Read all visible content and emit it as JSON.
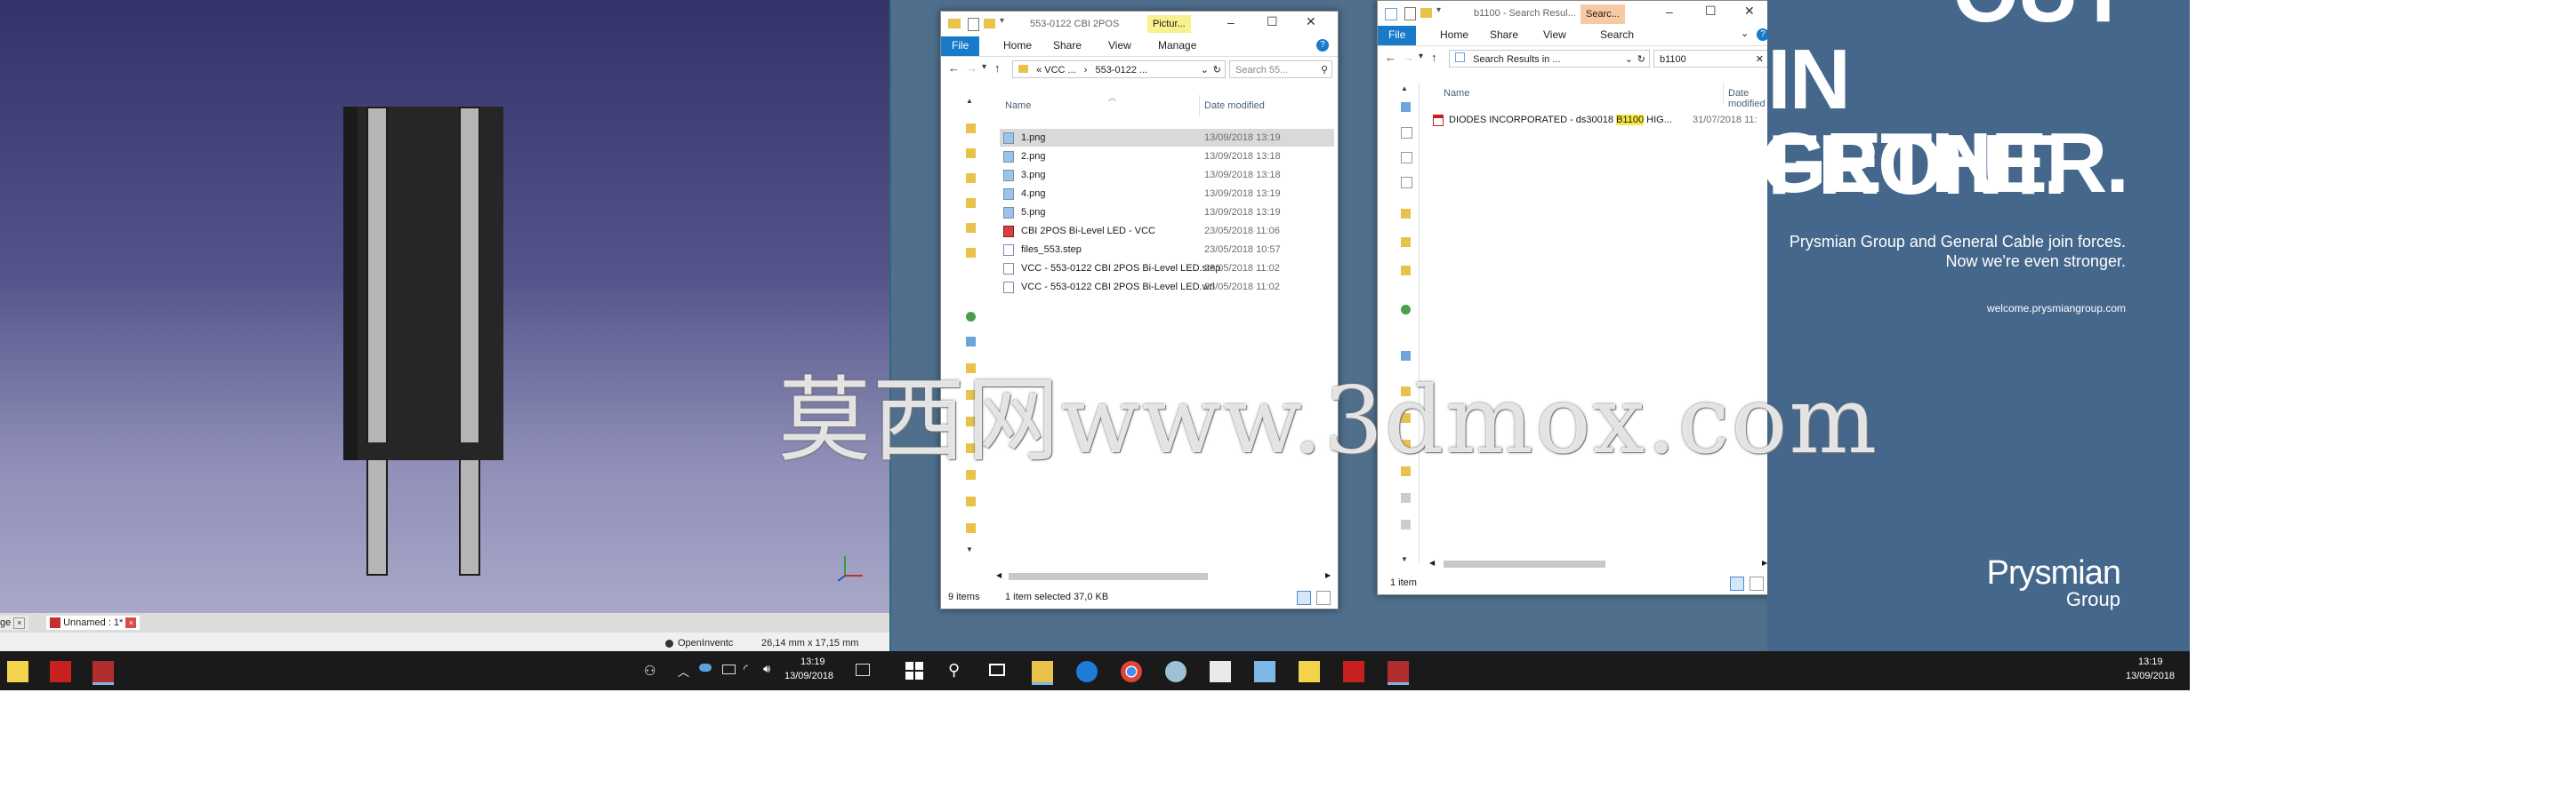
{
  "cad": {
    "tabs": [
      {
        "label": "ge"
      },
      {
        "label": "Unnamed : 1*"
      }
    ],
    "status_nav": "OpenInventc",
    "status_dims": "26,14 mm x 17,15 mm"
  },
  "taskbar_left": {
    "time": "13:19",
    "date": "13/09/2018"
  },
  "taskbar_right": {
    "time": "13:19",
    "date": "13/09/2018"
  },
  "explorer1": {
    "title": "553-0122 CBI 2POS",
    "context_tab": "Pictur...",
    "ribbon": [
      "File",
      "Home",
      "Share",
      "View",
      "Manage"
    ],
    "address": [
      "« VCC ...",
      "553-0122 ..."
    ],
    "search_placeholder": "Search 55...",
    "col_name": "Name",
    "col_date": "Date modified",
    "files": [
      {
        "name": "1.png",
        "date": "13/09/2018 13:19"
      },
      {
        "name": "2.png",
        "date": "13/09/2018 13:18"
      },
      {
        "name": "3.png",
        "date": "13/09/2018 13:18"
      },
      {
        "name": "4.png",
        "date": "13/09/2018 13:19"
      },
      {
        "name": "5.png",
        "date": "13/09/2018 13:19"
      },
      {
        "name": "CBI 2POS Bi-Level LED - VCC",
        "date": "23/05/2018 11:06"
      },
      {
        "name": "files_553.step",
        "date": "23/05/2018 10:57"
      },
      {
        "name": "VCC - 553-0122 CBI 2POS Bi-Level LED.step",
        "date": "23/05/2018 11:02"
      },
      {
        "name": "VCC - 553-0122 CBI 2POS Bi-Level LED.wrl",
        "date": "23/05/2018 11:02"
      }
    ],
    "status_count": "9 items",
    "status_selected": "1 item selected  37,0 KB"
  },
  "explorer2": {
    "title": "b1100 - Search Resul...",
    "context_tab": "Searc...",
    "ribbon": [
      "File",
      "Home",
      "Share",
      "View",
      "Search"
    ],
    "address": "Search Results in ...",
    "search_value": "b1100",
    "col_name": "Name",
    "col_date": "Date modified",
    "result": {
      "pre": "DIODES INCORPORATED - ds30018 ",
      "hit": "B1100",
      "post": " HIG...",
      "date": "31/07/2018 11:"
    },
    "status_count": "1 item"
  },
  "ad": {
    "line0": "OUT",
    "line1": "IN FRONT.",
    "line2": "TOGETHER.",
    "tagline1": "Prysmian Group and General Cable join forces.",
    "tagline2": "Now we're even stronger.",
    "url": "welcome.prysmiangroup.com",
    "logo1": "Prysmian",
    "logo2": "Group"
  },
  "watermark": "莫西网www.3dmox.com"
}
